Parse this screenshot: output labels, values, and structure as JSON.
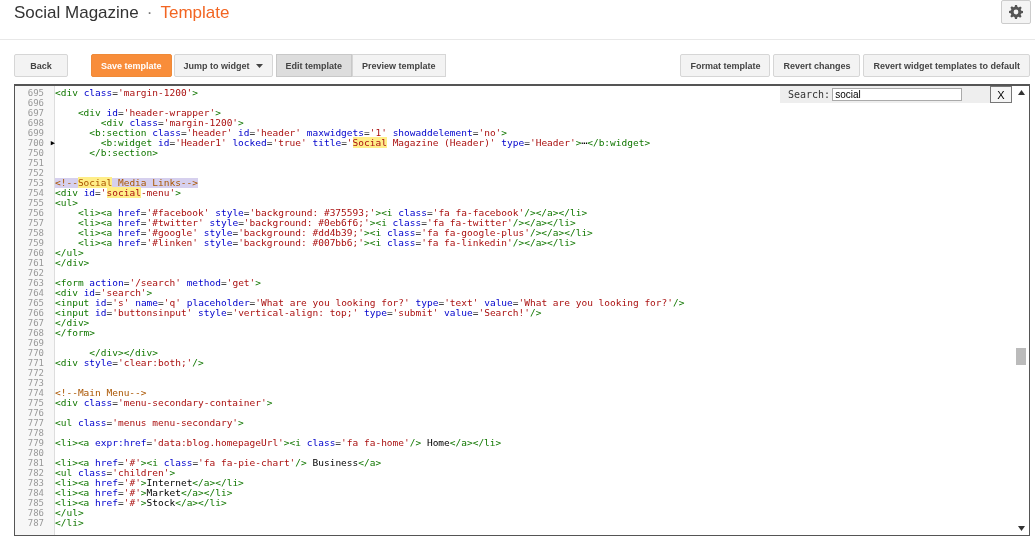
{
  "header": {
    "blog_title": "Social Magazine",
    "separator": "·",
    "page_title": "Template"
  },
  "toolbar": {
    "back": "Back",
    "save": "Save template",
    "jump": "Jump to widget",
    "modes": [
      {
        "label": "Edit template",
        "selected": true
      },
      {
        "label": "Preview template",
        "selected": false
      }
    ],
    "actions": [
      "Format template",
      "Revert changes",
      "Revert widget templates to default"
    ]
  },
  "search": {
    "label": "Search:",
    "value": "social",
    "close": "X"
  },
  "lines": [
    {
      "number": "695",
      "current": false,
      "code": [
        {
          "text": "<div class='margin-1200'>",
          "hit": false
        }
      ]
    },
    {
      "number": "696",
      "current": false
    },
    {
      "number": "697",
      "current": false,
      "code": [
        {
          "text": "    <div id='header-wrapper'>",
          "hit": false
        }
      ]
    },
    {
      "number": "698",
      "current": false,
      "code": [
        {
          "text": "        <div class='margin-1200'>",
          "hit": false
        }
      ]
    },
    {
      "number": "699",
      "current": false,
      "code": [
        {
          "text": "      <b:section class='header' id='header' maxwidgets='1' showaddelement='no'>",
          "hit": false
        }
      ]
    },
    {
      "number": "700",
      "marker": "▶",
      "current": false,
      "code": [
        {
          "text": "        <b:widget id='Header1' locked='true' title='",
          "hit": false
        },
        {
          "text": "Social",
          "hit": true
        },
        {
          "text": " Magazine (Header)' type='Header'>⋯</b:widget>",
          "hit": false
        }
      ]
    },
    {
      "number": "750",
      "current": false,
      "code": [
        {
          "text": "      </b:section>",
          "hit": false
        }
      ]
    },
    {
      "number": "751",
      "current": false
    },
    {
      "number": "752",
      "current": false
    },
    {
      "number": "753",
      "current": true,
      "code": [
        {
          "text": "<!--",
          "hit": false
        },
        {
          "text": "Social",
          "hit": true
        },
        {
          "text": " Media Links-->",
          "hit": false
        }
      ]
    },
    {
      "number": "754",
      "current": false,
      "code": [
        {
          "text": "<div id='",
          "hit": false
        },
        {
          "text": "social",
          "hit": true
        },
        {
          "text": "-menu'>",
          "hit": false
        }
      ]
    },
    {
      "number": "755",
      "current": false,
      "code": [
        {
          "text": "<ul>",
          "hit": false
        }
      ]
    },
    {
      "number": "756",
      "current": false,
      "code": [
        {
          "text": "    <li><a href='#facebook' style='background: #375593;'><i class='fa fa-facebook'/></a></li>",
          "hit": false
        }
      ]
    },
    {
      "number": "757",
      "current": false,
      "code": [
        {
          "text": "    <li><a href='#twitter' style='background: #0eb6f6;'><i class='fa fa-twitter'/></a></li>",
          "hit": false
        }
      ]
    },
    {
      "number": "758",
      "current": false,
      "code": [
        {
          "text": "    <li><a href='#google' style='background: #dd4b39;'><i class='fa fa-google-plus'/></a></li>",
          "hit": false
        }
      ]
    },
    {
      "number": "759",
      "current": false,
      "code": [
        {
          "text": "    <li><a href='#linken' style='background: #007bb6;'><i class='fa fa-linkedin'/></a></li>",
          "hit": false
        }
      ]
    },
    {
      "number": "760",
      "current": false,
      "code": [
        {
          "text": "</ul>",
          "hit": false
        }
      ]
    },
    {
      "number": "761",
      "current": false,
      "code": [
        {
          "text": "</div>",
          "hit": false
        }
      ]
    },
    {
      "number": "762",
      "current": false
    },
    {
      "number": "763",
      "current": false,
      "code": [
        {
          "text": "<form action='/search' method='get'>",
          "hit": false
        }
      ]
    },
    {
      "number": "764",
      "current": false,
      "code": [
        {
          "text": "<div id='search'>",
          "hit": false
        }
      ]
    },
    {
      "number": "765",
      "current": false,
      "code": [
        {
          "text": "<input id='s' name='q' placeholder='What are you looking for?' type='text' value='What are you looking for?'/>",
          "hit": false
        }
      ]
    },
    {
      "number": "766",
      "current": false,
      "code": [
        {
          "text": "<input id='buttonsinput' style='vertical-align: top;' type='submit' value='Search!'/>",
          "hit": false
        }
      ]
    },
    {
      "number": "767",
      "current": false,
      "code": [
        {
          "text": "</div>",
          "hit": false
        }
      ]
    },
    {
      "number": "768",
      "current": false,
      "code": [
        {
          "text": "</form>",
          "hit": false
        }
      ]
    },
    {
      "number": "769",
      "current": false
    },
    {
      "number": "770",
      "current": false,
      "code": [
        {
          "text": "      </div></div>",
          "hit": false
        }
      ]
    },
    {
      "number": "771",
      "current": false,
      "code": [
        {
          "text": "<div style='clear:both;'/>",
          "hit": false
        }
      ]
    },
    {
      "number": "772",
      "current": false
    },
    {
      "number": "773",
      "current": false
    },
    {
      "number": "774",
      "current": false,
      "code": [
        {
          "text": "<!--Main Menu-->",
          "hit": false
        }
      ]
    },
    {
      "number": "775",
      "current": false,
      "code": [
        {
          "text": "<div class='menu-secondary-container'>",
          "hit": false
        }
      ]
    },
    {
      "number": "776",
      "current": false
    },
    {
      "number": "777",
      "current": false,
      "code": [
        {
          "text": "<ul class='menus menu-secondary'>",
          "hit": false
        }
      ]
    },
    {
      "number": "778",
      "current": false
    },
    {
      "number": "779",
      "current": false,
      "code": [
        {
          "text": "<li><a expr:href='data:blog.homepageUrl'><i class='fa fa-home'/> Home</a></li>",
          "hit": false
        }
      ]
    },
    {
      "number": "780",
      "current": false
    },
    {
      "number": "781",
      "current": false,
      "code": [
        {
          "text": "<li><a href='#'><i class='fa fa-pie-chart'/> Business</a>",
          "hit": false
        }
      ]
    },
    {
      "number": "782",
      "current": false,
      "code": [
        {
          "text": "<ul class='children'>",
          "hit": false
        }
      ]
    },
    {
      "number": "783",
      "current": false,
      "code": [
        {
          "text": "<li><a href='#'>Internet</a></li>",
          "hit": false
        }
      ]
    },
    {
      "number": "784",
      "current": false,
      "code": [
        {
          "text": "<li><a href='#'>Market</a></li>",
          "hit": false
        }
      ]
    },
    {
      "number": "785",
      "current": false,
      "code": [
        {
          "text": "<li><a href='#'>Stock</a></li>",
          "hit": false
        }
      ]
    },
    {
      "number": "786",
      "current": false,
      "code": [
        {
          "text": "</ul>",
          "hit": false
        }
      ]
    },
    {
      "number": "787",
      "current": false,
      "code": [
        {
          "text": "</li>",
          "hit": false
        }
      ]
    }
  ]
}
